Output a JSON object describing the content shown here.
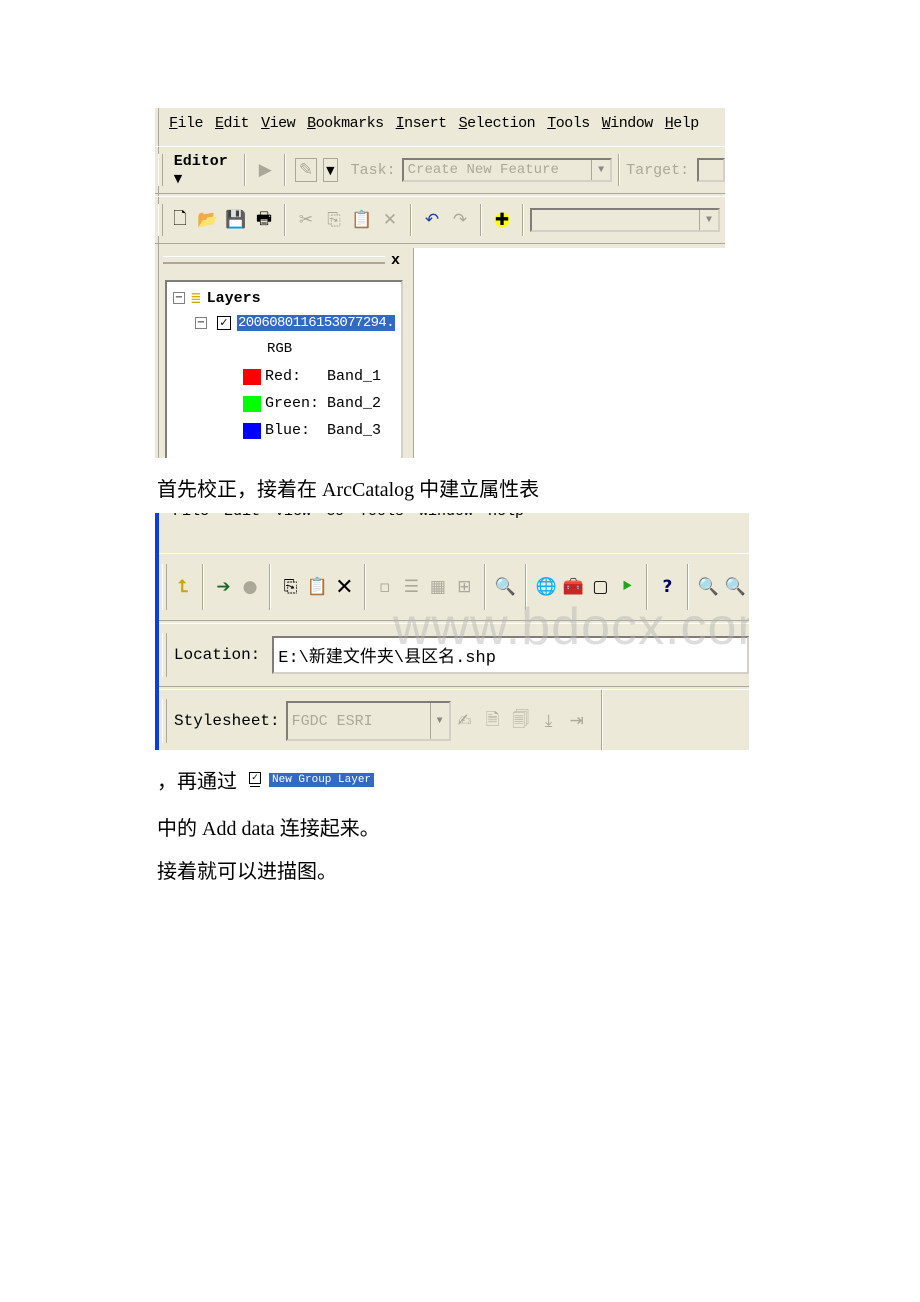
{
  "screenshot1": {
    "menu": [
      {
        "label": "File",
        "u": "F",
        "rest": "ile"
      },
      {
        "label": "Edit",
        "u": "E",
        "rest": "dit"
      },
      {
        "label": "View",
        "u": "V",
        "rest": "iew"
      },
      {
        "label": "Bookmarks",
        "u": "B",
        "rest": "ookmarks"
      },
      {
        "label": "Insert",
        "u": "I",
        "rest": "nsert"
      },
      {
        "label": "Selection",
        "u": "S",
        "rest": "election"
      },
      {
        "label": "Tools",
        "u": "T",
        "rest": "ools"
      },
      {
        "label": "Window",
        "u": "W",
        "rest": "indow"
      },
      {
        "label": "Help",
        "u": "H",
        "rest": "elp"
      }
    ],
    "editor_label": "Editor",
    "task_label": "Task:",
    "task_value": "Create New Feature",
    "target_label": "Target:",
    "toc": {
      "root": "Layers",
      "layer_name": "2006080116153077294.",
      "layer_checked": true,
      "renderer": "RGB",
      "bands": [
        {
          "channel": "Red:",
          "band": "Band_1",
          "color": "#ff0000"
        },
        {
          "channel": "Green:",
          "band": "Band_2",
          "color": "#00ff00"
        },
        {
          "channel": "Blue:",
          "band": "Band_3",
          "color": "#0000ff"
        }
      ],
      "close_label": "x"
    },
    "selection_color": "#316ac5"
  },
  "paragraph1": "首先校正，接着在 ArcCatalog 中建立属性表",
  "screenshot2": {
    "menu_text": "File Edit View Go Tools Window Help",
    "location_label": "Location:",
    "location_value": "E:\\新建文件夹\\县区名.shp",
    "stylesheet_label": "Stylesheet:",
    "stylesheet_value": "FGDC ESRI"
  },
  "watermark": "www.bdocx.com",
  "paragraph2_prefix": "，再通过",
  "inline_layer_label": "New Group Layer",
  "paragraph3": "中的 Add data 连接起来。",
  "paragraph4": "接着就可以进描图。"
}
